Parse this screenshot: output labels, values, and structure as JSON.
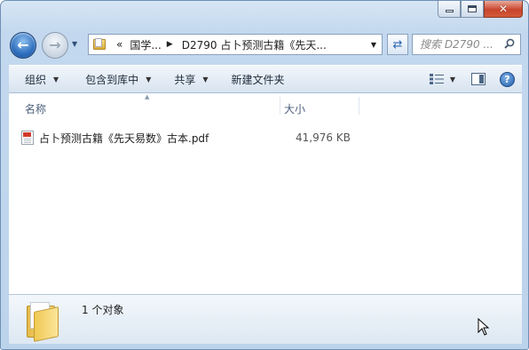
{
  "window": {
    "controls": {
      "minimize": "minimize",
      "maximize": "maximize",
      "close": "✕"
    }
  },
  "nav": {
    "back_icon": "back-arrow-icon",
    "forward_icon": "forward-arrow-icon"
  },
  "address": {
    "overflow": "«",
    "segments": [
      "国学...",
      "D2790 占卜预测古籍《先天..."
    ]
  },
  "search": {
    "placeholder": "搜索 D2790 ..."
  },
  "toolbar": {
    "organize": "组织",
    "include_in_library": "包含到库中",
    "share": "共享",
    "new_folder": "新建文件夹"
  },
  "columns": {
    "name": "名称",
    "size": "大小"
  },
  "files": [
    {
      "name": "占卜预测古籍《先天易数》古本.pdf",
      "size": "41,976 KB",
      "icon": "pdf-icon"
    }
  ],
  "details": {
    "count": "1 个对象"
  },
  "colors": {
    "accent": "#2f6fbf",
    "pdf_red": "#d33a2a",
    "folder": "#f0c953"
  }
}
